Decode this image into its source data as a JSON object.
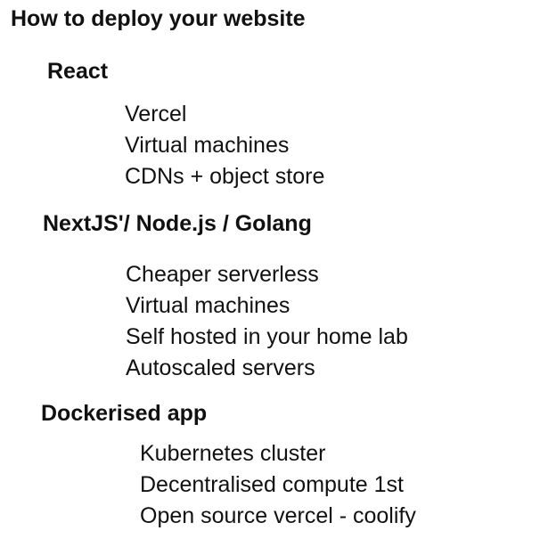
{
  "title": "How to deploy your website",
  "sections": [
    {
      "heading": "React",
      "items": [
        "Vercel",
        "Virtual machines",
        "CDNs + object store"
      ]
    },
    {
      "heading": "NextJS'/ Node.js / Golang",
      "items": [
        "Cheaper serverless",
        "Virtual machines",
        "Self hosted in your home lab",
        "Autoscaled servers"
      ]
    },
    {
      "heading": "Dockerised app",
      "items": [
        "Kubernetes cluster",
        "Decentralised compute 1st",
        "Open source vercel - coolify"
      ]
    }
  ]
}
